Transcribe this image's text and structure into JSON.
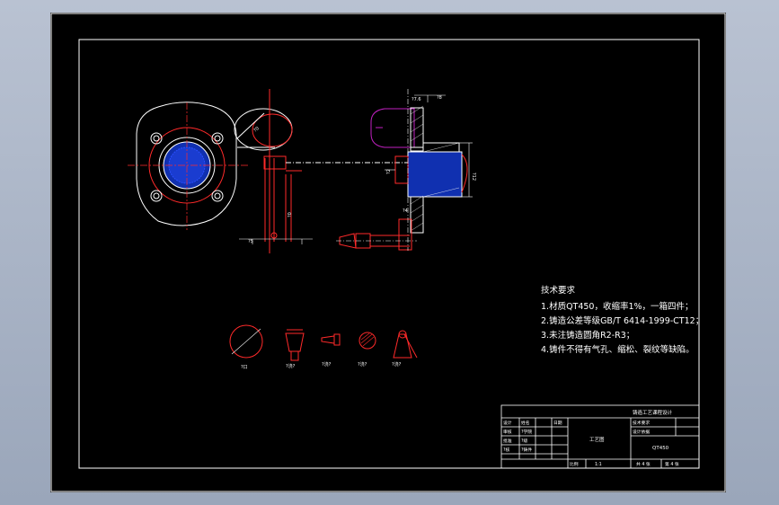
{
  "drawing": {
    "technical_requirements": {
      "heading": "技术要求",
      "items": [
        "1.材质QT450，收缩率1%，一箱四件；",
        "2.铸造公差等级GB/T 6414-1999-CT12；",
        "3.未注铸造圆角R2-R3；",
        "4.铸件不得有气孔、缩松、裂纹等缺陷。"
      ]
    },
    "dimensions": {
      "d1": "?7.6",
      "d2": "?8",
      "d3": "?12",
      "d4": "?2",
      "d5": "?4",
      "d6": "?0",
      "d7": "?0",
      "d8": "?5"
    },
    "component_labels": {
      "c1": "?口",
      "c2": "?浇?",
      "c3": "?浇?",
      "c4": "?浇?",
      "c5": "?浇?"
    },
    "title_block": {
      "project_title": "铸造工艺课程设计",
      "drawing_name": "工艺图",
      "material": "QT450",
      "scale_label": "比例",
      "scale_value": "1:1",
      "sheet_count": "共 4 张",
      "sheet_number": "第 4 张",
      "designer_label": "设计",
      "reviewer_label": "审核",
      "approver_label": "批准",
      "row4_label": "?核",
      "school_label": "?学院",
      "class_label": "?级",
      "cast_label": "?铸件",
      "name_label": "姓名",
      "date_label": "日期",
      "tech_label": "技术要求",
      "design_basis": "设计依据"
    }
  }
}
